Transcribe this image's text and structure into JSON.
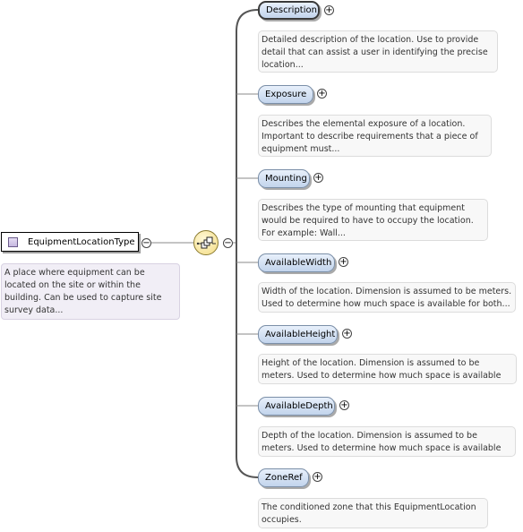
{
  "root": {
    "name": "EquipmentLocationType",
    "description": "A place where equipment can be located on the site or within the building. Can be used to capture site survey data..."
  },
  "icons": {
    "root_type": "complex-type-icon",
    "sequence": "sequence-compositor-icon",
    "collapse": "minus-circle-icon",
    "expand": "plus-circle-icon"
  },
  "toggle_symbols": {
    "collapse": "−",
    "expand": "+"
  },
  "colors": {
    "pill_fill": "#c2d4ec",
    "pill_border": "#7b8fa8",
    "connector": "#888888",
    "description_fill": "#f8f8f8",
    "root_description_fill": "#f1eef6",
    "sequence_fill": "#f3dc84"
  },
  "children": [
    {
      "name": "Description",
      "description": "Detailed description of the location. Use to provide detail that can assist a user in identifying the precise location..."
    },
    {
      "name": "Exposure",
      "description": "Describes the elemental exposure of a location. Important to describe requirements that a piece of equipment must..."
    },
    {
      "name": "Mounting",
      "description": "Describes the type of mounting that equipment would be required to have to occupy the location. For example: Wall..."
    },
    {
      "name": "AvailableWidth",
      "description": "Width of the location. Dimension is assumed to be meters. Used to determine how much space is available for both..."
    },
    {
      "name": "AvailableHeight",
      "description": "Height of the location. Dimension is assumed to be meters. Used to determine how much space is available for both..."
    },
    {
      "name": "AvailableDepth",
      "description": "Depth of the location. Dimension is assumed to be meters. Used to determine how much space is available for both..."
    },
    {
      "name": "ZoneRef",
      "description": "The conditioned zone that this EquipmentLocation occupies."
    }
  ]
}
